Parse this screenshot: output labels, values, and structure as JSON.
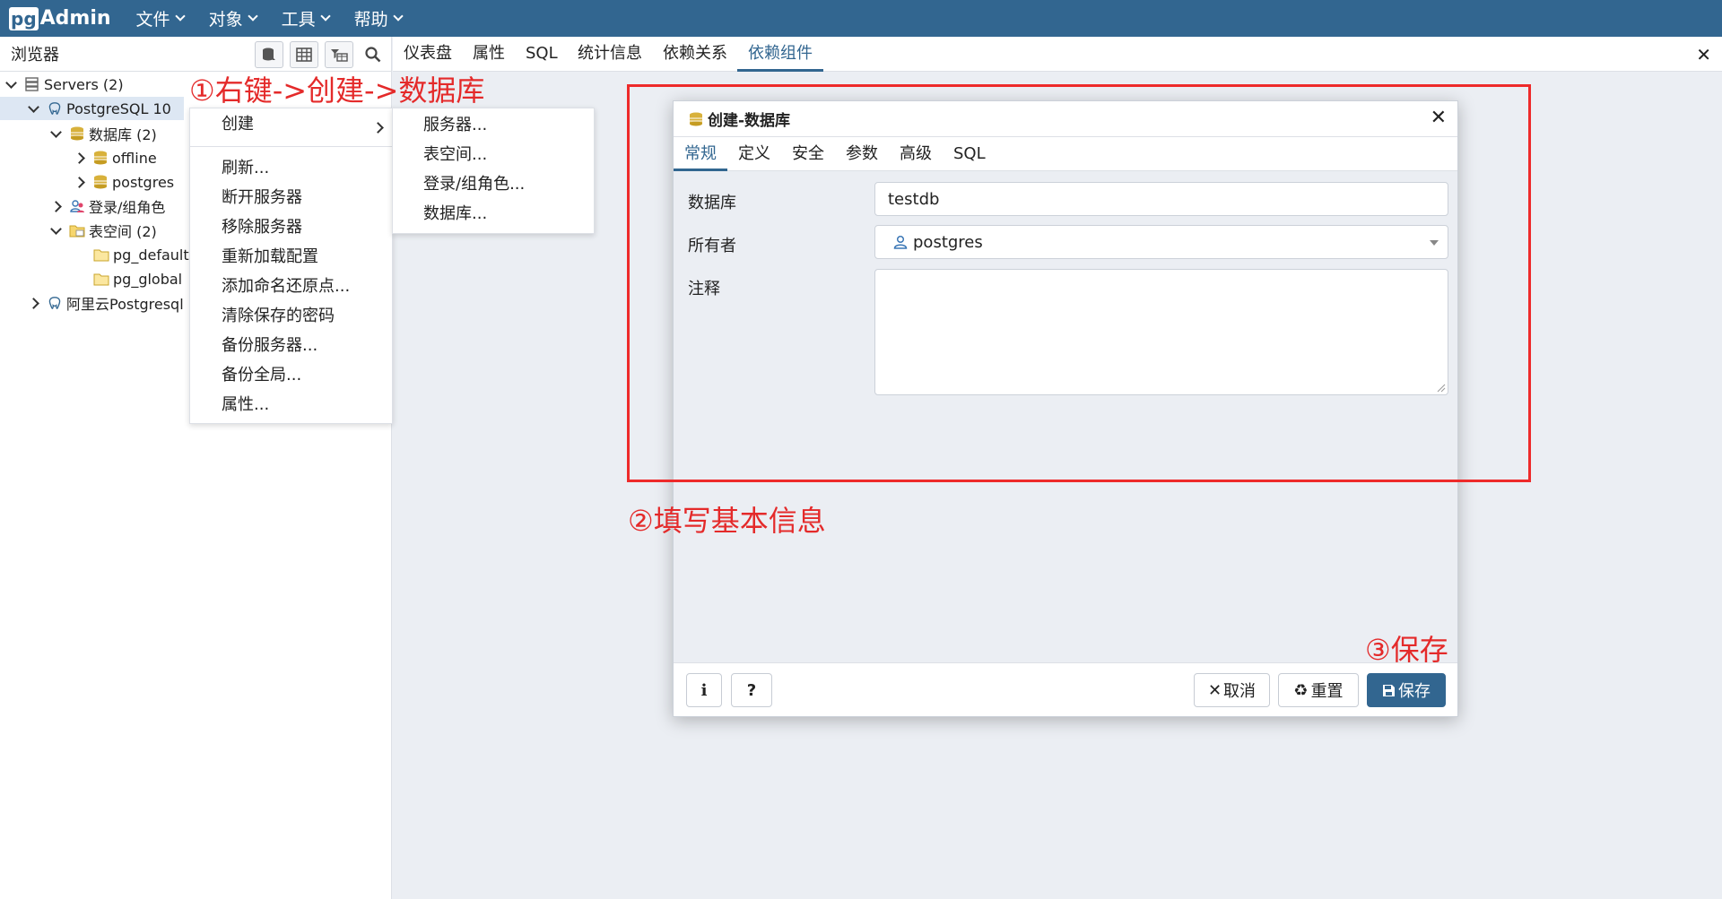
{
  "app": {
    "logo_pg": "pg",
    "logo_admin": "Admin"
  },
  "topmenu": [
    {
      "label": "文件"
    },
    {
      "label": "对象"
    },
    {
      "label": "工具"
    },
    {
      "label": "帮助"
    }
  ],
  "browser": {
    "title": "浏览器",
    "tree": {
      "servers": "Servers (2)",
      "postgres10": "PostgreSQL 10",
      "databases": "数据库 (2)",
      "offline": "offline",
      "postgres": "postgres",
      "login_roles": "登录/组角色",
      "tablespaces": "表空间 (2)",
      "pg_default": "pg_default",
      "pg_global": "pg_global",
      "aliyun": "阿里云Postgresql"
    }
  },
  "tabs": [
    {
      "label": "仪表盘"
    },
    {
      "label": "属性"
    },
    {
      "label": "SQL"
    },
    {
      "label": "统计信息"
    },
    {
      "label": "依赖关系"
    },
    {
      "label": "依赖组件"
    }
  ],
  "context_menu": {
    "create": "创建",
    "items": [
      "刷新...",
      "断开服务器",
      "移除服务器",
      "重新加载配置",
      "添加命名还原点...",
      "清除保存的密码",
      "备份服务器...",
      "备份全局...",
      "属性..."
    ]
  },
  "submenu": [
    "服务器...",
    "表空间...",
    "登录/组角色...",
    "数据库..."
  ],
  "dialog": {
    "title": "创建-数据库",
    "tabs": [
      "常规",
      "定义",
      "安全",
      "参数",
      "高级",
      "SQL"
    ],
    "fields": {
      "database_label": "数据库",
      "database_value": "testdb",
      "owner_label": "所有者",
      "owner_value": "postgres",
      "comment_label": "注释",
      "comment_value": ""
    },
    "buttons": {
      "info": "i",
      "help": "?",
      "cancel": "取消",
      "reset": "重置",
      "save": "保存"
    }
  },
  "annotations": {
    "step1": "①右键->创建->数据库",
    "step2": "②填写基本信息",
    "step3": "③保存"
  },
  "colors": {
    "brand": "#326690",
    "annotation": "#e42a2a"
  }
}
